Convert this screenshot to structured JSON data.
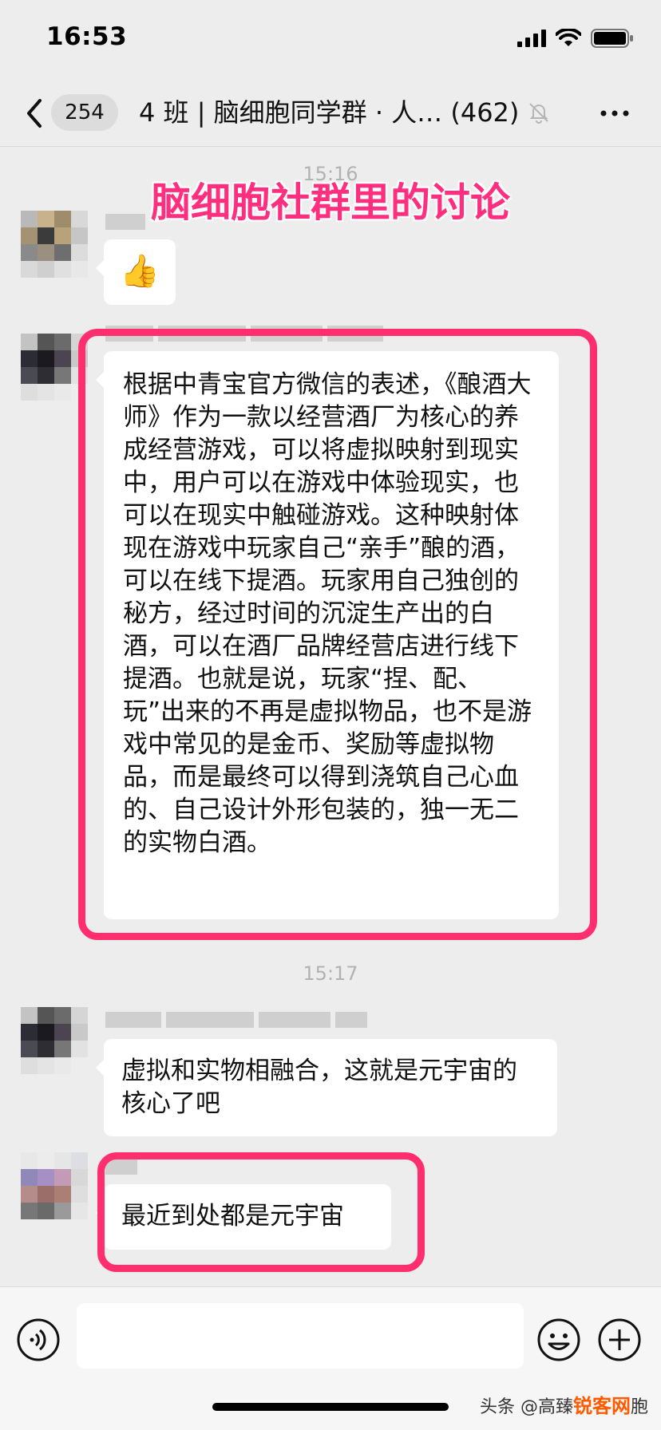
{
  "status_bar": {
    "time": "16:53",
    "icons": [
      "signal-icon",
      "wifi-icon",
      "battery-icon"
    ]
  },
  "nav": {
    "unread_count": "254",
    "title": "4 班 | 脑细胞同学群 · 人… (462)",
    "icons": [
      "back-icon",
      "mute-bell-icon",
      "more-icon"
    ]
  },
  "overlay_title": "脑细胞社群里的讨论",
  "messages": {
    "time_top": "15:16",
    "thumbs_up": "👍",
    "long_text": "根据中青宝官方微信的表述，《酿酒大师》作为一款以经营酒厂为核心的养成经营游戏，可以将虚拟映射到现实中，用户可以在游戏中体验现实，也可以在现实中触碰游戏。这种映射体现在游戏中玩家自己“亲手”酿的酒，可以在线下提酒。玩家用自己独创的秘方，经过时间的沉淀生产出的白酒，可以在酒厂品牌经营店进行线下提酒。也就是说，玩家“捏、配、玩”出来的不再是虚拟物品，也不是游戏中常见的是金币、奖励等虚拟物品，而是最终可以得到浇筑自己心血的、自己设计外形包装的，独一无二的实物白酒。",
    "time_mid": "15:17",
    "reply_1": "虚拟和实物相融合，这就是元宇宙的核心了吧",
    "reply_2": "最近到处都是元宇宙"
  },
  "input_bar": {
    "icons": [
      "voice-icon",
      "emoji-icon",
      "plus-icon"
    ]
  },
  "watermark": {
    "prefix": "头条 @高臻",
    "brand": "锐客网",
    "suffix": "胞"
  },
  "colors": {
    "accent_pink": "#ff2e6e",
    "background": "#ededed",
    "bubble": "#ffffff"
  }
}
